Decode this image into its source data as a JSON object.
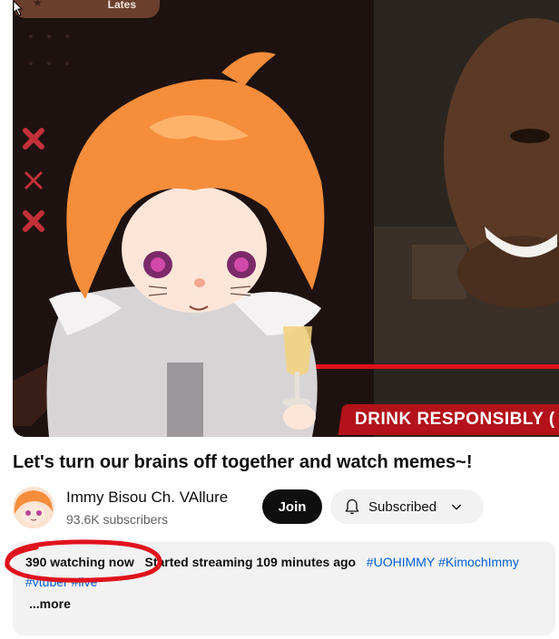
{
  "player": {
    "overlay_label": "Lates",
    "banner_text": "DRINK RESPONSIBLY ("
  },
  "video": {
    "title": "Let's turn our brains off together and watch memes~!"
  },
  "channel": {
    "name": "Immy Bisou Ch. VAllure",
    "subscribers": "93.6K subscribers",
    "join_label": "Join",
    "subscribed_label": "Subscribed"
  },
  "description": {
    "watching": "390 watching now",
    "started": "Started streaming 109 minutes ago",
    "hashtags_line1": [
      "#UOHIMMY",
      "#KimochImmy"
    ],
    "hashtags_line2": [
      "#vtuber",
      "#live"
    ],
    "more_label": "...more"
  },
  "colors": {
    "banner": "#b3121a",
    "hashtag": "#065fd4",
    "annotation": "#e0121c"
  }
}
